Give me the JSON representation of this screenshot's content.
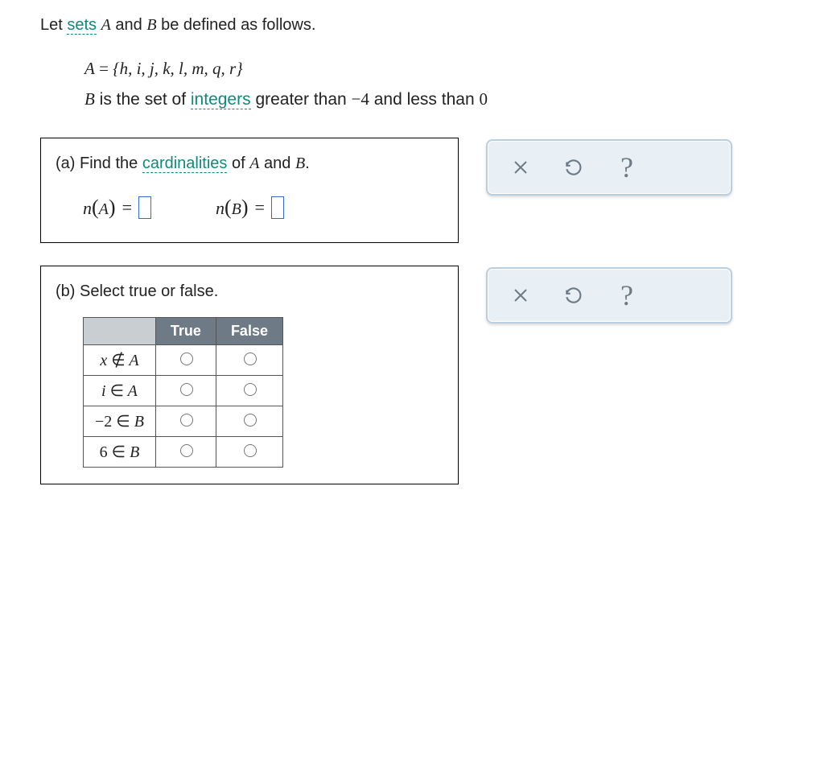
{
  "intro": {
    "prefix": "Let ",
    "sets_term": "sets",
    "middle": " ",
    "A": "A",
    "and": " and ",
    "B": "B",
    "suffix": " be defined as follows."
  },
  "defs": {
    "line1": {
      "A": "A",
      "equals": " = ",
      "set": "{h, i, j, k, l, m, q, r}"
    },
    "line2": {
      "B": "B",
      "text1": " is the set of ",
      "integers_term": "integers",
      "text2": " greater than ",
      "neg4": "−4",
      "text3": " and less than ",
      "zero": "0"
    }
  },
  "part_a": {
    "label": "(a) Find the ",
    "card_term": "cardinalities",
    "label2": " of ",
    "A": "A",
    "and": " and ",
    "B": "B",
    "period": ".",
    "nA_prefix": "n",
    "nA_paren": "(A)",
    "eq": " = ",
    "nB_prefix": "n",
    "nB_paren": "(B)"
  },
  "part_b": {
    "label": "(b) Select true or false.",
    "headers": {
      "true": "True",
      "false": "False"
    },
    "rows": [
      {
        "stmt_pre": "x",
        "symbol": "∉",
        "stmt_post": " A"
      },
      {
        "stmt_pre": "i",
        "symbol": "∈",
        "stmt_post": " A"
      },
      {
        "stmt_pre": "−2",
        "symbol": "∈",
        "stmt_post": " B"
      },
      {
        "stmt_pre": "6",
        "symbol": "∈",
        "stmt_post": " B"
      }
    ]
  }
}
